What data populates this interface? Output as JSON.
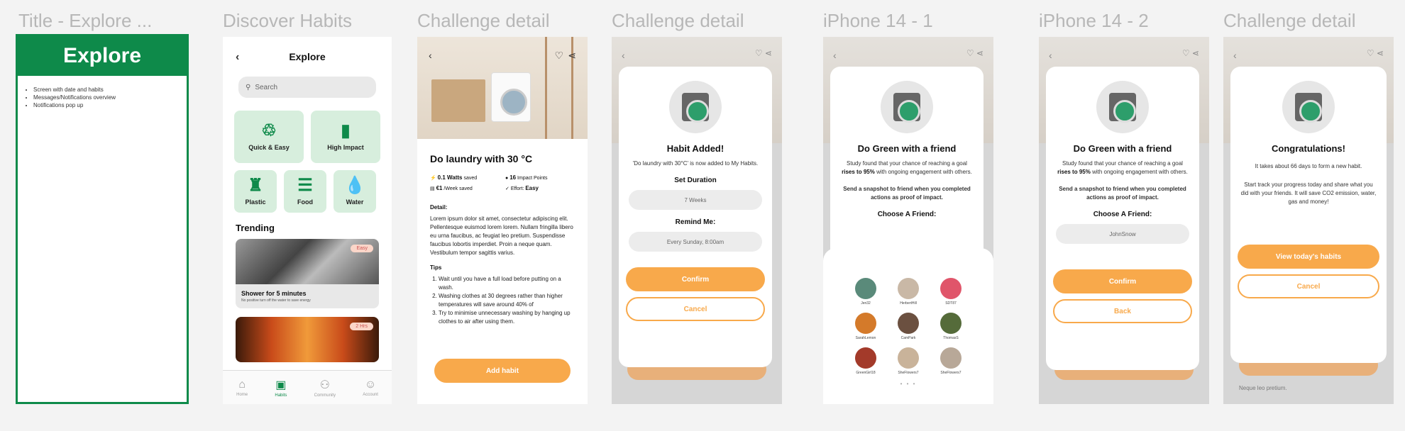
{
  "frames": {
    "f1": {
      "title": "Title - Explore ...",
      "banner": "Explore",
      "notes": [
        "Screen with date and habits",
        "Messages/Notifications overview",
        "Notifications pop up"
      ]
    },
    "f2": {
      "title": "Discover Habits",
      "header": "Explore",
      "search_placeholder": "Search",
      "categories_big": [
        {
          "label": "Quick & Easy",
          "icon": "♲"
        },
        {
          "label": "High Impact",
          "icon": "▮"
        }
      ],
      "categories_small": [
        {
          "label": "Plastic",
          "icon": "♜"
        },
        {
          "label": "Food",
          "icon": "☰"
        },
        {
          "label": "Water",
          "icon": "💧"
        }
      ],
      "section": "Trending",
      "cards": [
        {
          "title": "Shower for 5 minutes",
          "sub": "No positive turn off the water to save energy",
          "tag": "Easy"
        },
        {
          "title": "",
          "sub": "",
          "tag": "2 Hrs"
        }
      ],
      "tabs": [
        "Home",
        "Habits",
        "Community",
        "Account"
      ]
    },
    "f3": {
      "title": "Challenge detail",
      "habit": "Do laundry with 30 °C",
      "stats": [
        {
          "value": "0.1 Watts",
          "unit": "saved"
        },
        {
          "value": "16",
          "unit": "Impact Points"
        },
        {
          "value": "€1",
          "unit": "/Week saved"
        },
        {
          "value": "Easy",
          "unit": "Effort:"
        }
      ],
      "detail_label": "Detail:",
      "detail": "Lorem ipsum dolor sit amet, consectetur adipiscing elit. Pellentesque euismod lorem lorem. Nullam fringilla libero eu urna faucibus, ac feugiat leo pretium. Suspendisse faucibus lobortis imperdiet. Proin a neque quam. Vestibulum tempor sagittis varius.",
      "tips_label": "Tips",
      "tips": [
        "Wait until you have a full load before putting on a wash.",
        "Washing clothes at 30 degrees rather than higher temperatures will save around 40% of",
        "Try to minimise unnecessary washing by hanging up clothes to air after using them."
      ],
      "add_button": "Add habit"
    },
    "f4": {
      "title": "Challenge detail",
      "heading": "Habit Added!",
      "text": "'Do laundry with 30°C' is now added to My Habits.",
      "duration_label": "Set Duration",
      "duration_value": "7 Weeks",
      "remind_label": "Remind Me:",
      "remind_value": "Every Sunday, 8:00am",
      "confirm": "Confirm",
      "cancel": "Cancel"
    },
    "f5": {
      "title": "iPhone 14 - 1",
      "heading": "Do Green with a friend",
      "text1": "Study found that your chance of reaching a goal",
      "text_bold": "rises to 95%",
      "text2": "with ongoing engagement with others.",
      "text3": "Send a snapshot to friend when you completed actions as proof of impact.",
      "choose_label": "Choose A Friend:",
      "friends": [
        "Jen32",
        "HerbertHill",
        "SDT87",
        "SarahLemon",
        "CamPark",
        "ThomasS",
        "GreenGirl18",
        "SheFlowers7",
        "SheFlowers7"
      ]
    },
    "f6": {
      "title": "iPhone 14 - 2",
      "heading": "Do Green with a friend",
      "text1": "Study found that your chance of reaching a goal",
      "text_bold": "rises to 95%",
      "text2": "with ongoing engagement with others.",
      "text3": "Send a snapshot to friend when you completed actions as proof of impact.",
      "choose_label": "Choose A Friend:",
      "friend_value": "JohnSnow",
      "confirm": "Confirm",
      "back": "Back"
    },
    "f7": {
      "title": "Challenge detail",
      "heading": "Congratulations!",
      "text1": "It takes about 66 days to form a new habit.",
      "text2": "Start track your progress today and share what you did with your friends. It will save CO2 emission, water, gas and money!",
      "primary": "View today's habits",
      "cancel": "Cancel",
      "behind_text": "Neque leo pretium."
    }
  },
  "colors": {
    "brand_green": "#0e8a4a",
    "accent_orange": "#f8a94b",
    "tile_green": "#d7eedd"
  }
}
